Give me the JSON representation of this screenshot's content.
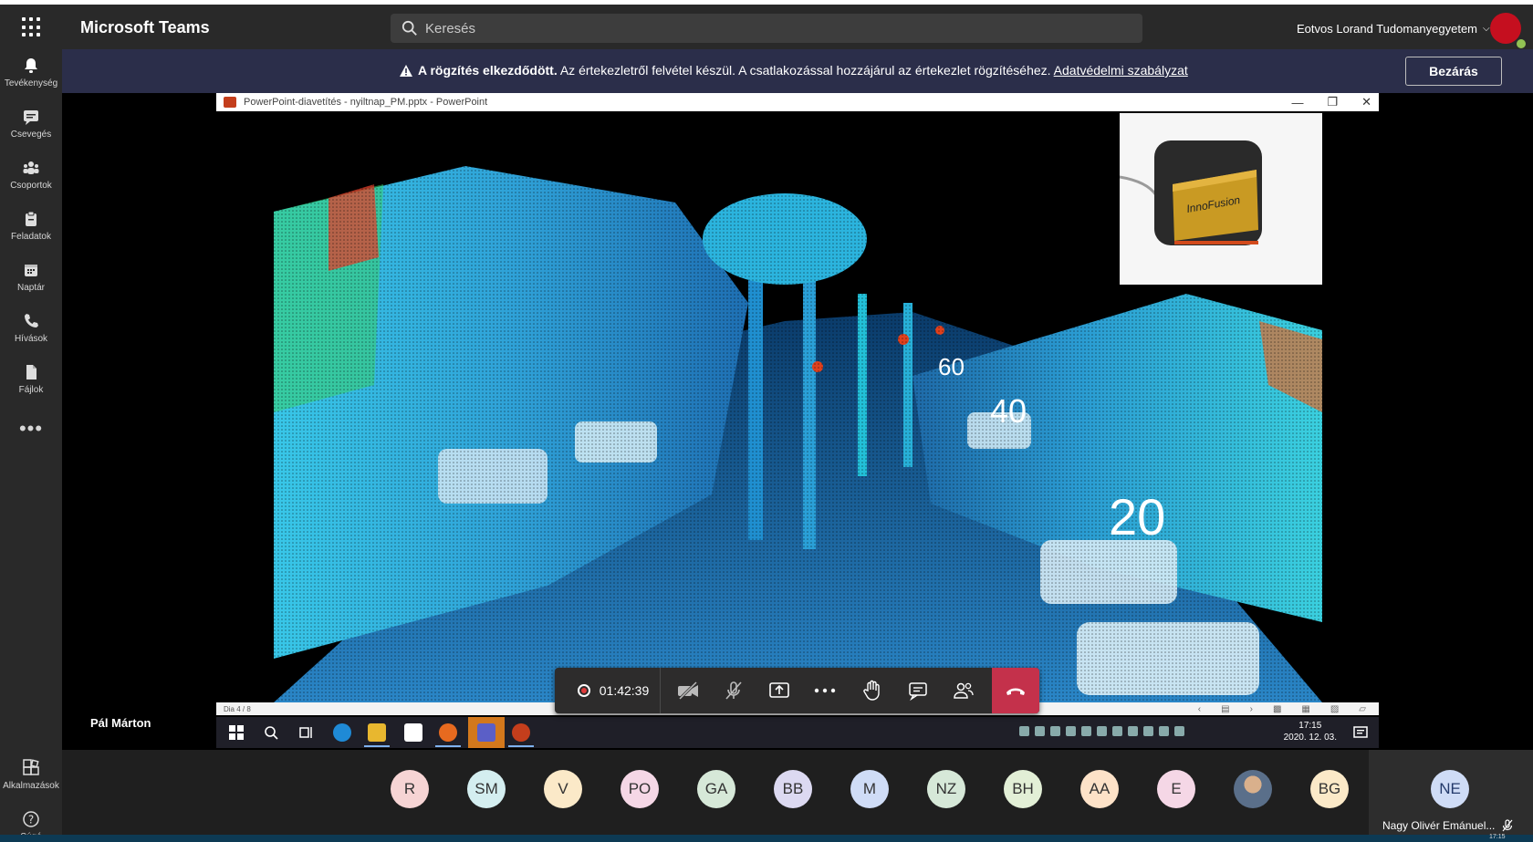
{
  "app": {
    "title": "Microsoft Teams",
    "tenant": "Eotvos Lorand Tudomanyegyetem"
  },
  "search": {
    "placeholder": "Keresés"
  },
  "rail": {
    "items": [
      {
        "label": "Tevékenység",
        "icon": "bell-icon"
      },
      {
        "label": "Csevegés",
        "icon": "chat-icon"
      },
      {
        "label": "Csoportok",
        "icon": "teams-icon"
      },
      {
        "label": "Feladatok",
        "icon": "assignments-icon"
      },
      {
        "label": "Naptár",
        "icon": "calendar-icon"
      },
      {
        "label": "Hívások",
        "icon": "phone-icon"
      },
      {
        "label": "Fájlok",
        "icon": "files-icon"
      }
    ],
    "more": "•••",
    "bottom": [
      {
        "label": "Alkalmazások",
        "icon": "apps-store-icon"
      },
      {
        "label": "Súgó",
        "icon": "help-icon"
      }
    ]
  },
  "banner": {
    "bold": "A rögzítés elkezdődött.",
    "text": " Az értekezletről felvétel készül. A csatlakozással hozzájárul az értekezlet rögzítéséhez. ",
    "link": "Adatvédelmi szabályzat",
    "close": "Bezárás"
  },
  "powerpoint": {
    "title": "PowerPoint-diavetítés  -  nyiltnap_PM.pptx - PowerPoint",
    "slide_status": "Dia 4 / 8",
    "distances": [
      "20",
      "40",
      "60"
    ],
    "inset_brand": "InnoFusion"
  },
  "taskbar": {
    "time": "17:15",
    "date": "2020. 12. 03."
  },
  "presenter": "Pál Márton",
  "call": {
    "timer": "01:42:39"
  },
  "participants": [
    {
      "initials": "R",
      "bg": "#f6d4d4"
    },
    {
      "initials": "SM",
      "bg": "#d4eef0"
    },
    {
      "initials": "V",
      "bg": "#fbe9c8"
    },
    {
      "initials": "PO",
      "bg": "#f5d7e6"
    },
    {
      "initials": "GA",
      "bg": "#d6e8d8"
    },
    {
      "initials": "BB",
      "bg": "#dcd9f1"
    },
    {
      "initials": "M",
      "bg": "#cfdcf6"
    },
    {
      "initials": "NZ",
      "bg": "#d6e8d8"
    },
    {
      "initials": "BH",
      "bg": "#e2efd6"
    },
    {
      "initials": "AA",
      "bg": "#fde2c8"
    },
    {
      "initials": "E",
      "bg": "#f5d7e6"
    },
    {
      "initials": "",
      "bg": "#b9a88f"
    },
    {
      "initials": "BG",
      "bg": "#fbe9c8"
    }
  ],
  "self": {
    "initials": "NE",
    "name": "Nagy Olivér Emánuel..."
  },
  "system": {
    "time": "17:15"
  },
  "colors": {
    "accent": "#6264a7",
    "hangup": "#c4314b",
    "banner": "#2b2e4a"
  }
}
